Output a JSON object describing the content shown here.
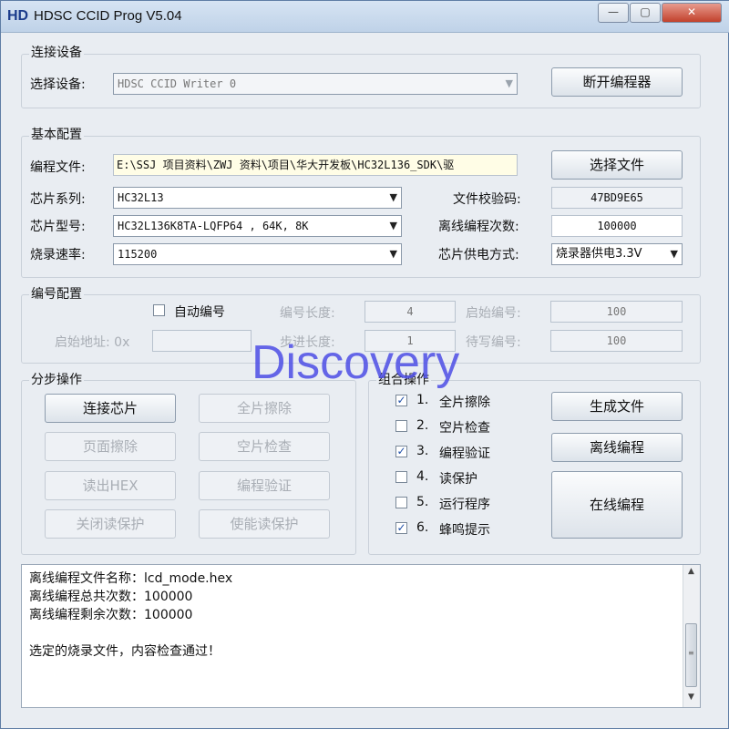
{
  "window": {
    "icon_text": "HD",
    "title": "HDSC CCID Prog V5.04",
    "controls": {
      "minimize": "—",
      "maximize": "▢",
      "close": "✕"
    }
  },
  "connect": {
    "group_title": "连接设备",
    "device_label": "选择设备:",
    "device_value": "HDSC CCID Writer 0",
    "disconnect_button": "断开编程器"
  },
  "basic": {
    "group_title": "基本配置",
    "program_file_label": "编程文件:",
    "program_file_value": "E:\\SSJ 项目资料\\ZWJ 资料\\项目\\华大开发板\\HC32L136_SDK\\驱",
    "select_file_button": "选择文件",
    "chip_series_label": "芯片系列:",
    "chip_series_value": "HC32L13",
    "chip_model_label": "芯片型号:",
    "chip_model_value": "HC32L136K8TA-LQFP64   , 64K, 8K",
    "burn_speed_label": "烧录速率:",
    "burn_speed_value": "115200",
    "checksum_label": "文件校验码:",
    "checksum_value": "47BD9E65",
    "offline_count_label": "离线编程次数:",
    "offline_count_value": "100000",
    "power_label": "芯片供电方式:",
    "power_value": "烧录器供电3.3V"
  },
  "numbering": {
    "group_title": "编号配置",
    "auto_number_label": "自动编号",
    "auto_number_checked": false,
    "number_length_label": "编号长度:",
    "number_length_value": "4",
    "start_number_label": "启始编号:",
    "start_number_value": "100",
    "start_address_label": "启始地址: 0x",
    "start_address_value": "",
    "step_label": "步进长度:",
    "step_value": "1",
    "pending_number_label": "待写编号:",
    "pending_number_value": "100"
  },
  "step_ops": {
    "group_title": "分步操作",
    "buttons": [
      "连接芯片",
      "全片擦除",
      "页面擦除",
      "空片检查",
      "读出HEX",
      "编程验证",
      "关闭读保护",
      "使能读保护"
    ]
  },
  "combo_ops": {
    "group_title": "组合操作",
    "items": [
      {
        "num": "1.",
        "label": "全片擦除",
        "checked": true
      },
      {
        "num": "2.",
        "label": "空片检查",
        "checked": false
      },
      {
        "num": "3.",
        "label": "编程验证",
        "checked": true
      },
      {
        "num": "4.",
        "label": "读保护",
        "checked": false
      },
      {
        "num": "5.",
        "label": "运行程序",
        "checked": false
      },
      {
        "num": "6.",
        "label": "蜂鸣提示",
        "checked": true
      }
    ],
    "generate_file_button": "生成文件",
    "offline_program_button": "离线编程",
    "online_program_button": "在线编程"
  },
  "log": {
    "lines": [
      "离线编程文件名称：lcd_mode.hex",
      "离线编程总共次数：100000",
      "离线编程剩余次数：100000",
      "",
      "选定的烧录文件，内容检查通过！"
    ]
  },
  "watermark": "Discovery",
  "icons": {
    "dropdown": "chevron-down-icon",
    "check": "checkmark-icon",
    "scroll_up": "arrow-up-icon",
    "scroll_down": "arrow-down-icon"
  }
}
